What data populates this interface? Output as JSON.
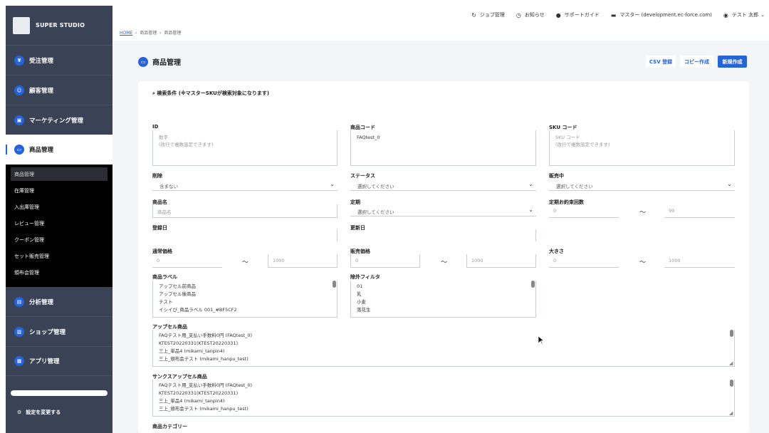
{
  "brand": {
    "name": "SUPER STUDIO"
  },
  "sidebar": {
    "items": [
      {
        "label": "受注管理",
        "icon": "cart-icon"
      },
      {
        "label": "顧客管理",
        "icon": "user-icon"
      },
      {
        "label": "マーケティング管理",
        "icon": "megaphone-icon"
      },
      {
        "label": "商品管理",
        "icon": "box-icon"
      },
      {
        "label": "分析管理",
        "icon": "chart-icon"
      },
      {
        "label": "ショップ管理",
        "icon": "shop-icon"
      },
      {
        "label": "アプリ管理",
        "icon": "app-icon"
      }
    ],
    "submenu": [
      "商品管理",
      "在庫管理",
      "入出庫管理",
      "レビュー管理",
      "クーポン管理",
      "セット販売管理",
      "頒布会管理"
    ],
    "settings": "設定を変更する"
  },
  "topbar": {
    "job": "ジョブ管理",
    "notice": "お知らせ",
    "support": "サポートガイド",
    "shop": "マスター (development.ec-force.com)",
    "user": "テスト 太郎"
  },
  "breadcrumb": {
    "home": "HOME",
    "level1": "商品管理",
    "level2": "商品管理"
  },
  "page": {
    "title": "商品管理"
  },
  "buttons": {
    "csv": "CSV 登録",
    "copy": "コピー作成",
    "new": "新規作成"
  },
  "search": {
    "heading": "検索条件 (※マスターSKUが検索対象になります)",
    "id": {
      "label": "ID",
      "placeholder1": "数字",
      "placeholder2": "(改行で複数設定できます)"
    },
    "code": {
      "label": "商品コード",
      "value": "FAQtest_0"
    },
    "sku": {
      "label": "SKU コード",
      "placeholder1": "SKU コード",
      "placeholder2": "(改行で複数設定できます)"
    },
    "deleted": {
      "label": "削除",
      "value": "含まない"
    },
    "status": {
      "label": "ステータス",
      "value": "選択してください"
    },
    "onsale": {
      "label": "販売中",
      "value": "選択してください"
    },
    "name": {
      "label": "商品名",
      "placeholder": "商品名"
    },
    "subscription": {
      "label": "定期",
      "value": "選択してください"
    },
    "promise": {
      "label": "定期お約束回数",
      "from": "0",
      "to": "99"
    },
    "created": {
      "label": "登録日"
    },
    "updated": {
      "label": "更新日"
    },
    "normal_price": {
      "label": "通常価格",
      "from": "0",
      "to": "1000"
    },
    "sale_price": {
      "label": "販売価格",
      "from": "0",
      "to": "1000"
    },
    "size": {
      "label": "大きさ",
      "from": "0",
      "to": "1000"
    },
    "product_label": {
      "label": "商品ラベル",
      "options": [
        "アップセル前商品",
        "アップセル後商品",
        "テスト",
        "イシイび_商品ラベル 001_#BF5CF2"
      ]
    },
    "exclude_filter": {
      "label": "除外フィルタ",
      "options": [
        "01",
        "乳",
        "小麦",
        "落花生"
      ]
    },
    "upsell": {
      "label": "アップセル商品",
      "options": [
        "FAQテスト用_支払い手数料0円 (FAQtest_0)",
        "KTEST20220331(KTEST20220331)",
        "三上_単品4 (mikami_tanpin4)",
        "三上_頒布会テスト (mikami_hanpu_test)"
      ]
    },
    "thanks_upsell": {
      "label": "サンクスアップセル商品",
      "options": [
        "FAQテスト用_支払い手数料0円 (FAQtest_0)",
        "KTEST20220331(KTEST20220331)",
        "三上_単品4 (mikami_tanpin4)",
        "三上_頒布会テスト (mikami_hanpu_test)"
      ]
    },
    "category": {
      "label": "商品カテゴリー"
    }
  },
  "tilde": "〜"
}
